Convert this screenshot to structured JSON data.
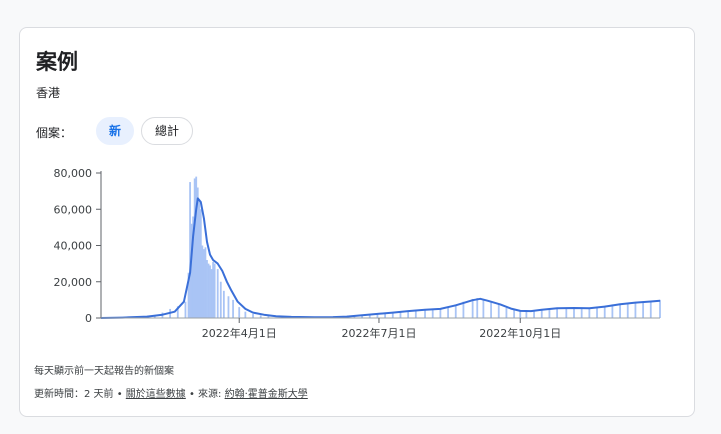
{
  "card": {
    "title": "案例",
    "region": "香港",
    "toggle_label": "個案：",
    "toggle_new": "新",
    "toggle_total": "總計",
    "note": "每天顯示前一天起報告的新個案",
    "updated_prefix": "更新時間：2 天前 • ",
    "about_link": "關於這些數據",
    "source_prefix": " • 來源: ",
    "source_link": "約翰·霍普金斯大學"
  },
  "colors": {
    "bar": "#a9c4f5",
    "line": "#3a6fd8",
    "chip_active_bg": "#e8f0fe",
    "chip_active_text": "#1a73e8"
  },
  "chart_data": {
    "type": "bar",
    "title": "",
    "xlabel": "",
    "ylabel": "",
    "x_range": [
      "2022-01-01",
      "2022-12-31"
    ],
    "ylim": [
      0,
      80000
    ],
    "y_ticks": [
      {
        "value": 0,
        "label": "0"
      },
      {
        "value": 20000,
        "label": "20,000"
      },
      {
        "value": 40000,
        "label": "40,000"
      },
      {
        "value": 60000,
        "label": "60,000"
      },
      {
        "value": 80000,
        "label": "80,000"
      }
    ],
    "x_ticks": [
      {
        "date": "2022-04-01",
        "label": "2022年4月1日"
      },
      {
        "date": "2022-07-01",
        "label": "2022年7月1日"
      },
      {
        "date": "2022-10-01",
        "label": "2022年10月1日"
      }
    ],
    "series": [
      {
        "kind": "bar",
        "points": [
          [
            "2022-01-01",
            0
          ],
          [
            "2022-01-10",
            100
          ],
          [
            "2022-01-20",
            400
          ],
          [
            "2022-01-31",
            1200
          ],
          [
            "2022-02-05",
            1500
          ],
          [
            "2022-02-10",
            3000
          ],
          [
            "2022-02-15",
            5000
          ],
          [
            "2022-02-20",
            6500
          ],
          [
            "2022-02-25",
            9000
          ],
          [
            "2022-02-27",
            25000
          ],
          [
            "2022-02-28",
            75000
          ],
          [
            "2022-03-01",
            52000
          ],
          [
            "2022-03-02",
            56000
          ],
          [
            "2022-03-03",
            77000
          ],
          [
            "2022-03-04",
            78000
          ],
          [
            "2022-03-05",
            72000
          ],
          [
            "2022-03-06",
            65000
          ],
          [
            "2022-03-07",
            60000
          ],
          [
            "2022-03-08",
            40000
          ],
          [
            "2022-03-09",
            38000
          ],
          [
            "2022-03-10",
            39000
          ],
          [
            "2022-03-11",
            32000
          ],
          [
            "2022-03-12",
            30000
          ],
          [
            "2022-03-13",
            29000
          ],
          [
            "2022-03-14",
            27000
          ],
          [
            "2022-03-15",
            31000
          ],
          [
            "2022-03-16",
            30000
          ],
          [
            "2022-03-18",
            27000
          ],
          [
            "2022-03-20",
            20000
          ],
          [
            "2022-03-22",
            15000
          ],
          [
            "2022-03-25",
            12000
          ],
          [
            "2022-03-28",
            10000
          ],
          [
            "2022-04-01",
            6000
          ],
          [
            "2022-04-05",
            3500
          ],
          [
            "2022-04-10",
            2200
          ],
          [
            "2022-04-15",
            1500
          ],
          [
            "2022-04-20",
            1000
          ],
          [
            "2022-04-30",
            700
          ],
          [
            "2022-05-10",
            400
          ],
          [
            "2022-05-20",
            300
          ],
          [
            "2022-05-31",
            300
          ],
          [
            "2022-06-05",
            400
          ],
          [
            "2022-06-10",
            700
          ],
          [
            "2022-06-15",
            1000
          ],
          [
            "2022-06-20",
            1500
          ],
          [
            "2022-06-25",
            1800
          ],
          [
            "2022-06-30",
            2200
          ],
          [
            "2022-07-05",
            2600
          ],
          [
            "2022-07-10",
            3000
          ],
          [
            "2022-07-15",
            3300
          ],
          [
            "2022-07-20",
            4000
          ],
          [
            "2022-07-25",
            4400
          ],
          [
            "2022-07-31",
            4800
          ],
          [
            "2022-08-05",
            4500
          ],
          [
            "2022-08-10",
            4800
          ],
          [
            "2022-08-15",
            6000
          ],
          [
            "2022-08-20",
            7500
          ],
          [
            "2022-08-25",
            9000
          ],
          [
            "2022-08-31",
            10500
          ],
          [
            "2022-09-03",
            11000
          ],
          [
            "2022-09-07",
            10000
          ],
          [
            "2022-09-12",
            8500
          ],
          [
            "2022-09-17",
            7500
          ],
          [
            "2022-09-22",
            5500
          ],
          [
            "2022-09-27",
            4500
          ],
          [
            "2022-10-01",
            3800
          ],
          [
            "2022-10-05",
            3700
          ],
          [
            "2022-10-10",
            4000
          ],
          [
            "2022-10-15",
            4800
          ],
          [
            "2022-10-20",
            5300
          ],
          [
            "2022-10-25",
            5600
          ],
          [
            "2022-10-31",
            5700
          ],
          [
            "2022-11-05",
            5500
          ],
          [
            "2022-11-10",
            5400
          ],
          [
            "2022-11-15",
            5200
          ],
          [
            "2022-11-20",
            5600
          ],
          [
            "2022-11-25",
            6800
          ],
          [
            "2022-11-30",
            7500
          ],
          [
            "2022-12-05",
            8000
          ],
          [
            "2022-12-10",
            8500
          ],
          [
            "2022-12-15",
            8800
          ],
          [
            "2022-12-20",
            9200
          ],
          [
            "2022-12-25",
            9500
          ],
          [
            "2022-12-31",
            10000
          ]
        ]
      },
      {
        "kind": "line",
        "points": [
          [
            "2022-01-01",
            0
          ],
          [
            "2022-01-15",
            200
          ],
          [
            "2022-01-31",
            800
          ],
          [
            "2022-02-10",
            1800
          ],
          [
            "2022-02-18",
            3500
          ],
          [
            "2022-02-24",
            9000
          ],
          [
            "2022-02-28",
            25000
          ],
          [
            "2022-03-02",
            45000
          ],
          [
            "2022-03-04",
            60000
          ],
          [
            "2022-03-05",
            66000
          ],
          [
            "2022-03-07",
            64000
          ],
          [
            "2022-03-09",
            55000
          ],
          [
            "2022-03-11",
            42000
          ],
          [
            "2022-03-13",
            35000
          ],
          [
            "2022-03-15",
            32000
          ],
          [
            "2022-03-18",
            30000
          ],
          [
            "2022-03-21",
            26000
          ],
          [
            "2022-03-24",
            20000
          ],
          [
            "2022-03-27",
            15000
          ],
          [
            "2022-03-31",
            9000
          ],
          [
            "2022-04-05",
            5000
          ],
          [
            "2022-04-10",
            3000
          ],
          [
            "2022-04-17",
            1800
          ],
          [
            "2022-04-25",
            1000
          ],
          [
            "2022-05-05",
            600
          ],
          [
            "2022-05-20",
            400
          ],
          [
            "2022-06-01",
            500
          ],
          [
            "2022-06-10",
            800
          ],
          [
            "2022-06-20",
            1500
          ],
          [
            "2022-07-01",
            2300
          ],
          [
            "2022-07-10",
            3000
          ],
          [
            "2022-07-20",
            3800
          ],
          [
            "2022-07-31",
            4600
          ],
          [
            "2022-08-10",
            5000
          ],
          [
            "2022-08-20",
            7000
          ],
          [
            "2022-08-31",
            9800
          ],
          [
            "2022-09-05",
            10600
          ],
          [
            "2022-09-10",
            9500
          ],
          [
            "2022-09-18",
            7500
          ],
          [
            "2022-09-25",
            5200
          ],
          [
            "2022-10-01",
            3900
          ],
          [
            "2022-10-08",
            3800
          ],
          [
            "2022-10-15",
            4600
          ],
          [
            "2022-10-25",
            5400
          ],
          [
            "2022-11-05",
            5500
          ],
          [
            "2022-11-15",
            5400
          ],
          [
            "2022-11-25",
            6300
          ],
          [
            "2022-12-05",
            7600
          ],
          [
            "2022-12-15",
            8500
          ],
          [
            "2022-12-25",
            9100
          ],
          [
            "2022-12-31",
            9500
          ]
        ]
      }
    ]
  }
}
